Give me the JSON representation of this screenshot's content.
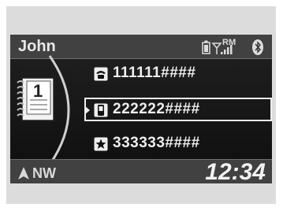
{
  "header": {
    "contact_name": "John",
    "signal_text": "RM"
  },
  "phonebook": {
    "entries": [
      {
        "icon": "home-phone-icon",
        "number": "111111####",
        "selected": false
      },
      {
        "icon": "mobile-phone-icon",
        "number": "222222####",
        "selected": true
      },
      {
        "icon": "star-favorite-icon",
        "number": "333333####",
        "selected": false
      }
    ]
  },
  "footer": {
    "compass_heading": "NW",
    "clock": "12:34"
  },
  "colors": {
    "screen_bg": "#000000",
    "bar_bg": "#414141",
    "text": "#eeeeee",
    "bezel": "#dcdcdc"
  }
}
